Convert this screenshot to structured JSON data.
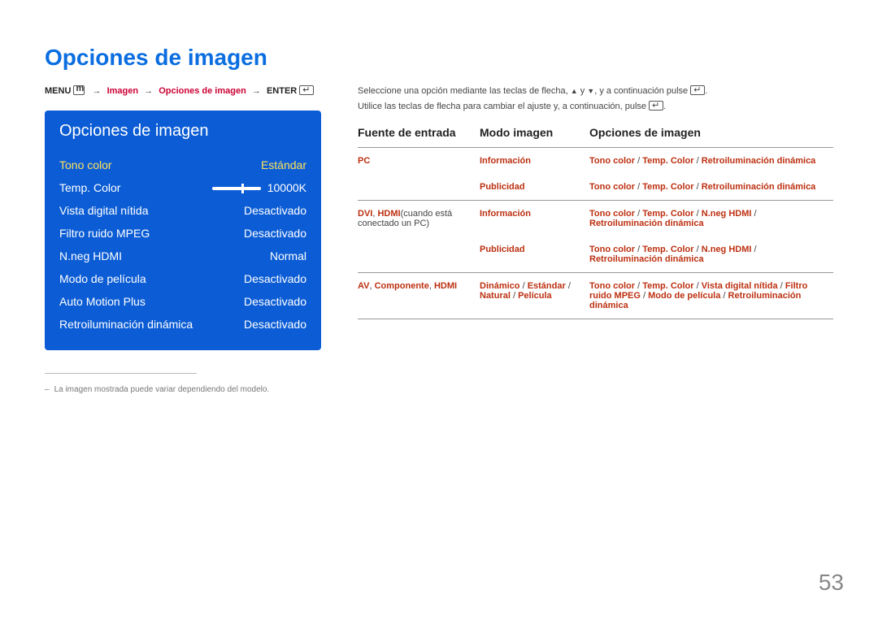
{
  "title": "Opciones de imagen",
  "breadcrumb": {
    "menu": "MENU",
    "imagen": "Imagen",
    "opciones": "Opciones de imagen",
    "enter": "ENTER"
  },
  "panel": {
    "title": "Opciones de imagen",
    "rows": [
      {
        "label": "Tono color",
        "value": "Estándar"
      },
      {
        "label": "Temp. Color",
        "value": "10000K"
      },
      {
        "label": "Vista digital nítida",
        "value": "Desactivado"
      },
      {
        "label": "Filtro ruido MPEG",
        "value": "Desactivado"
      },
      {
        "label": "N.neg HDMI",
        "value": "Normal"
      },
      {
        "label": "Modo de película",
        "value": "Desactivado"
      },
      {
        "label": "Auto Motion Plus",
        "value": "Desactivado"
      },
      {
        "label": "Retroiluminación dinámica",
        "value": "Desactivado"
      }
    ]
  },
  "note": "La imagen mostrada puede variar dependiendo del modelo.",
  "intro": {
    "line1a": "Seleccione una opción mediante las teclas de flecha, ",
    "line1b": " y ",
    "line1c": ", y a continuación pulse ",
    "line2a": "Utilice las teclas de flecha para cambiar el ajuste y, a continuación, pulse "
  },
  "table": {
    "headers": [
      "Fuente de entrada",
      "Modo imagen",
      "Opciones de imagen"
    ],
    "rows": [
      {
        "c1": [
          {
            "t": "PC",
            "cls": "red"
          }
        ],
        "c2": [
          {
            "t": "Información",
            "cls": "red"
          }
        ],
        "c3": [
          {
            "t": "Tono color",
            "cls": "red"
          },
          {
            "t": " / ",
            "cls": "black"
          },
          {
            "t": "Temp. Color",
            "cls": "red"
          },
          {
            "t": " / ",
            "cls": "black"
          },
          {
            "t": "Retroiluminación dinámica",
            "cls": "red"
          }
        ]
      },
      {
        "c1": [],
        "c2": [
          {
            "t": "Publicidad",
            "cls": "red"
          }
        ],
        "c3": [
          {
            "t": "Tono color",
            "cls": "red"
          },
          {
            "t": " / ",
            "cls": "black"
          },
          {
            "t": "Temp. Color",
            "cls": "red"
          },
          {
            "t": " / ",
            "cls": "black"
          },
          {
            "t": "Retroiluminación dinámica",
            "cls": "red"
          }
        ]
      },
      {
        "c1": [
          {
            "t": "DVI",
            "cls": "red"
          },
          {
            "t": ", ",
            "cls": "black"
          },
          {
            "t": "HDMI",
            "cls": "red"
          },
          {
            "t": "(cuando está conectado un PC)",
            "cls": "black"
          }
        ],
        "c2": [
          {
            "t": "Información",
            "cls": "red"
          }
        ],
        "c3": [
          {
            "t": "Tono color",
            "cls": "red"
          },
          {
            "t": " / ",
            "cls": "black"
          },
          {
            "t": "Temp. Color",
            "cls": "red"
          },
          {
            "t": " / ",
            "cls": "black"
          },
          {
            "t": "N.neg HDMI",
            "cls": "red"
          },
          {
            "t": " / ",
            "cls": "black"
          },
          {
            "t": "Retroiluminación dinámica",
            "cls": "red"
          }
        ]
      },
      {
        "c1": [],
        "c2": [
          {
            "t": "Publicidad",
            "cls": "red"
          }
        ],
        "c3": [
          {
            "t": "Tono color",
            "cls": "red"
          },
          {
            "t": " / ",
            "cls": "black"
          },
          {
            "t": "Temp. Color",
            "cls": "red"
          },
          {
            "t": " / ",
            "cls": "black"
          },
          {
            "t": "N.neg HDMI",
            "cls": "red"
          },
          {
            "t": " / ",
            "cls": "black"
          },
          {
            "t": "Retroiluminación dinámica",
            "cls": "red"
          }
        ]
      },
      {
        "c1": [
          {
            "t": "AV",
            "cls": "red"
          },
          {
            "t": ", ",
            "cls": "black"
          },
          {
            "t": "Componente",
            "cls": "red"
          },
          {
            "t": ", ",
            "cls": "black"
          },
          {
            "t": "HDMI",
            "cls": "red"
          }
        ],
        "c2": [
          {
            "t": "Dinámico",
            "cls": "red"
          },
          {
            "t": " / ",
            "cls": "black"
          },
          {
            "t": "Estándar",
            "cls": "red"
          },
          {
            "t": " / ",
            "cls": "black"
          },
          {
            "t": "Natural",
            "cls": "red"
          },
          {
            "t": " / ",
            "cls": "black"
          },
          {
            "t": "Película",
            "cls": "red"
          }
        ],
        "c3": [
          {
            "t": "Tono color",
            "cls": "red"
          },
          {
            "t": " / ",
            "cls": "black"
          },
          {
            "t": "Temp. Color",
            "cls": "red"
          },
          {
            "t": " / ",
            "cls": "black"
          },
          {
            "t": "Vista digital nítida",
            "cls": "red"
          },
          {
            "t": " / ",
            "cls": "black"
          },
          {
            "t": "Filtro ruido MPEG",
            "cls": "red"
          },
          {
            "t": " / ",
            "cls": "black"
          },
          {
            "t": "Modo de película",
            "cls": "red"
          },
          {
            "t": " / ",
            "cls": "black"
          },
          {
            "t": "Retroiluminación dinámica",
            "cls": "red"
          }
        ]
      }
    ]
  },
  "pageNumber": "53"
}
